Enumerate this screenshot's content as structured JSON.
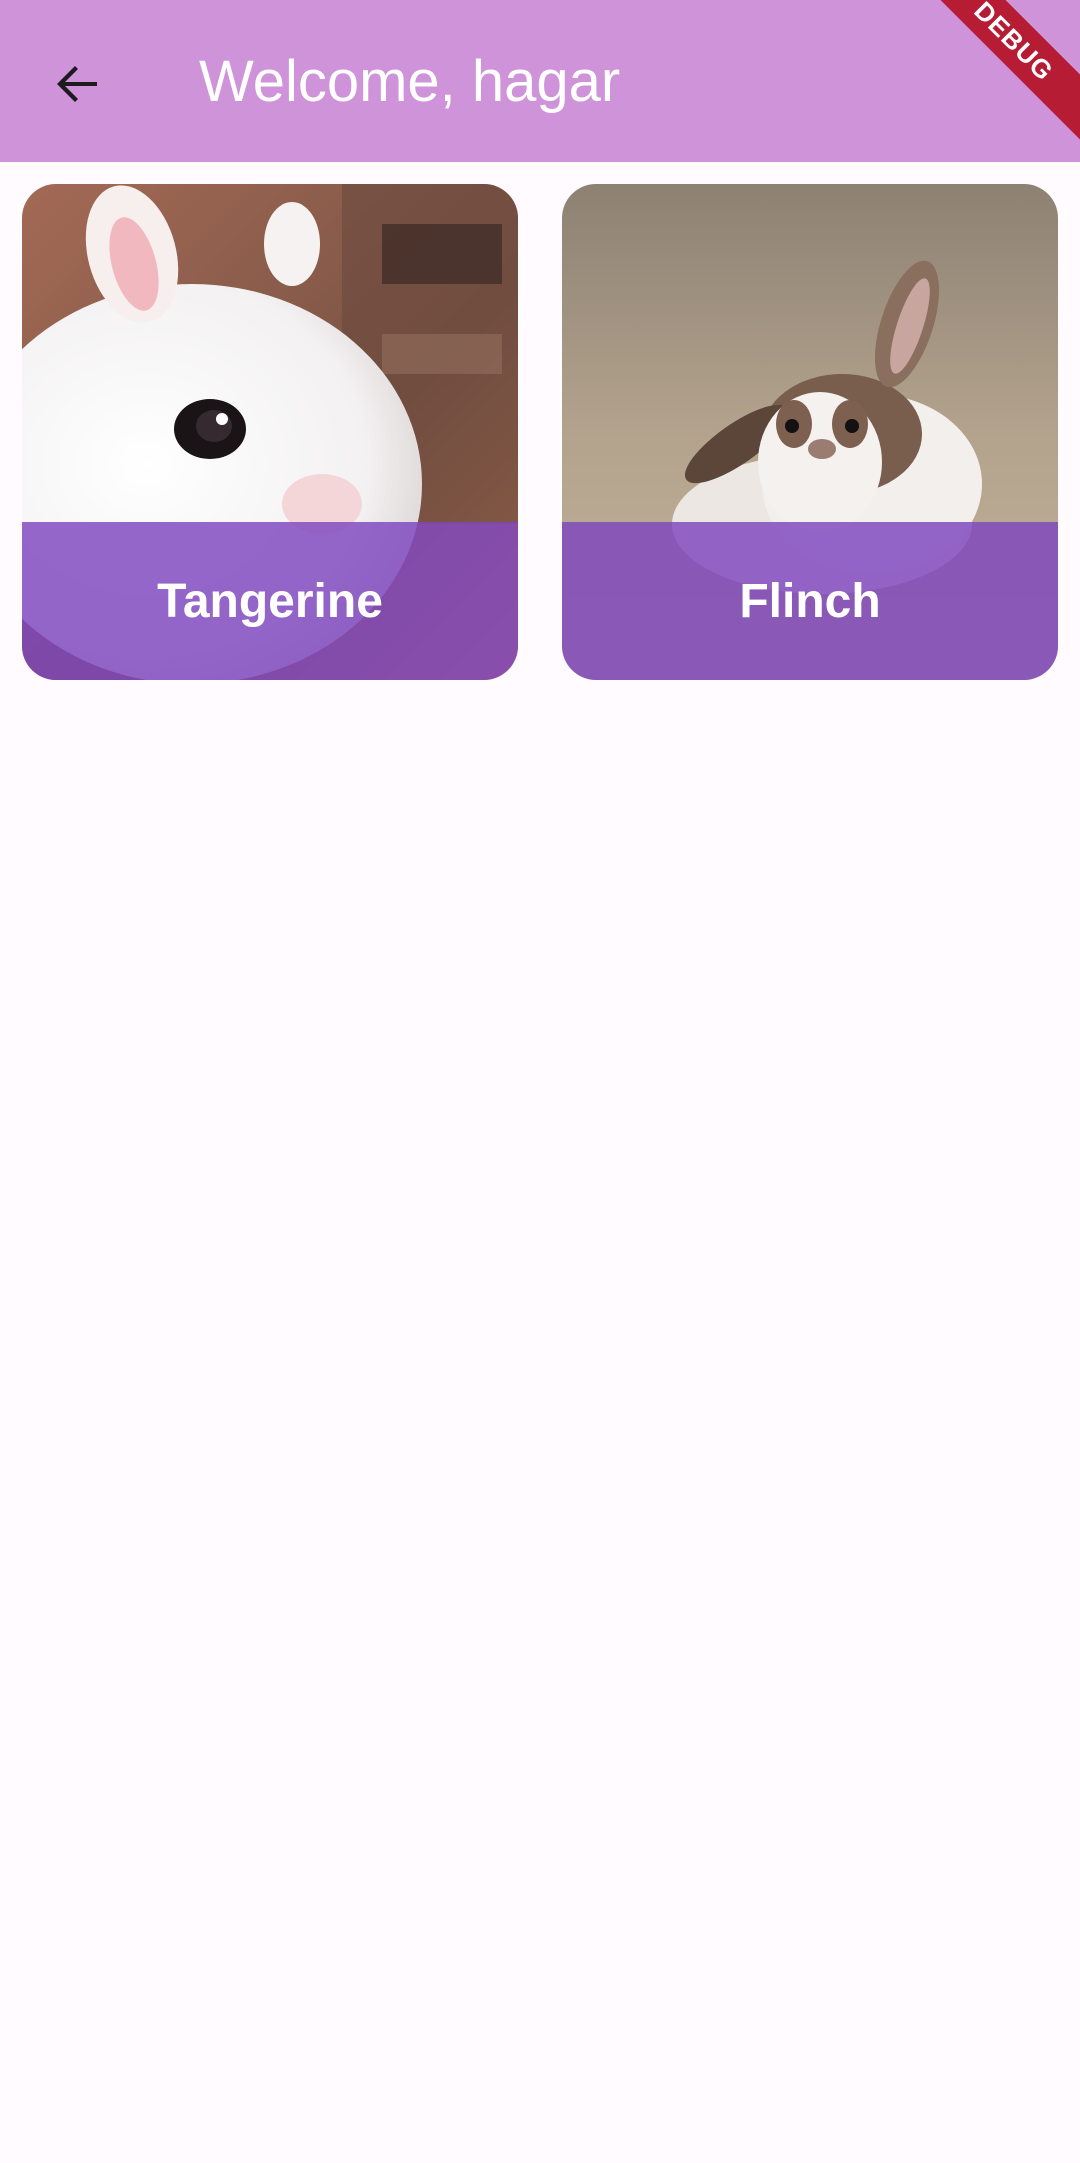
{
  "app_bar": {
    "title": "Welcome, hagar",
    "back_icon": "arrow-back-icon",
    "background": "#ce93d8",
    "debug_banner": "DEBUG"
  },
  "pets": [
    {
      "name": "Tangerine",
      "image": "white-rabbit-photo"
    },
    {
      "name": "Flinch",
      "image": "brown-white-rabbit-photo"
    }
  ],
  "colors": {
    "caption_overlay": "#7e46be",
    "page_background": "#fffbfe"
  }
}
